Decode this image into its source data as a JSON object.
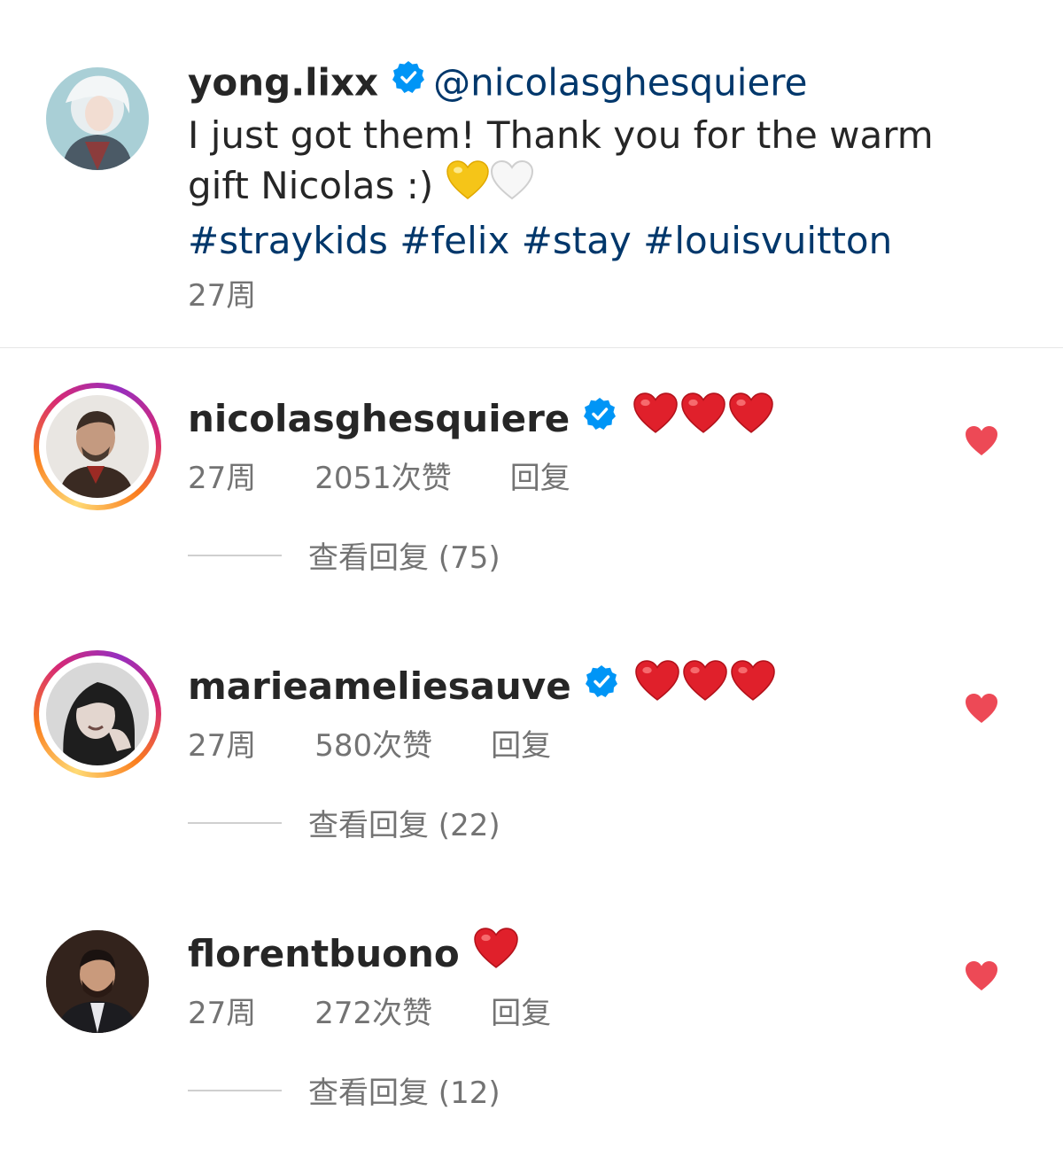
{
  "post": {
    "username": "yong.lixx",
    "mention": "@nicolasghesquiere",
    "caption_line1": "I just got them! Thank you for the warm",
    "caption_line2": "gift Nicolas :)",
    "hashtags": "#straykids #felix #stay #louisvuitton",
    "time": "27周"
  },
  "comments": [
    {
      "username": "nicolasghesquiere",
      "emoji_hearts": 3,
      "time": "27周",
      "likes": "2051次赞",
      "reply": "回复",
      "view_replies": "查看回复 (75)",
      "has_story_ring": true
    },
    {
      "username": "marieameliesauve",
      "emoji_hearts": 3,
      "time": "27周",
      "likes": "580次赞",
      "reply": "回复",
      "view_replies": "查看回复 (22)",
      "has_story_ring": true
    },
    {
      "username": "florentbuono",
      "emoji_hearts": 1,
      "time": "27周",
      "likes": "272次赞",
      "reply": "回复",
      "view_replies": "查看回复 (12)",
      "has_story_ring": false
    }
  ],
  "icons": {
    "verified": "verified-badge-icon",
    "heart_emoji": "red-heart-emoji",
    "yellow_heart_emoji": "yellow-heart-emoji",
    "white_heart_emoji": "white-heart-emoji",
    "like": "heart-icon"
  },
  "colors": {
    "link": "#00376b",
    "muted": "#737373",
    "verified": "#0095f6",
    "heart": "#ed4956"
  }
}
